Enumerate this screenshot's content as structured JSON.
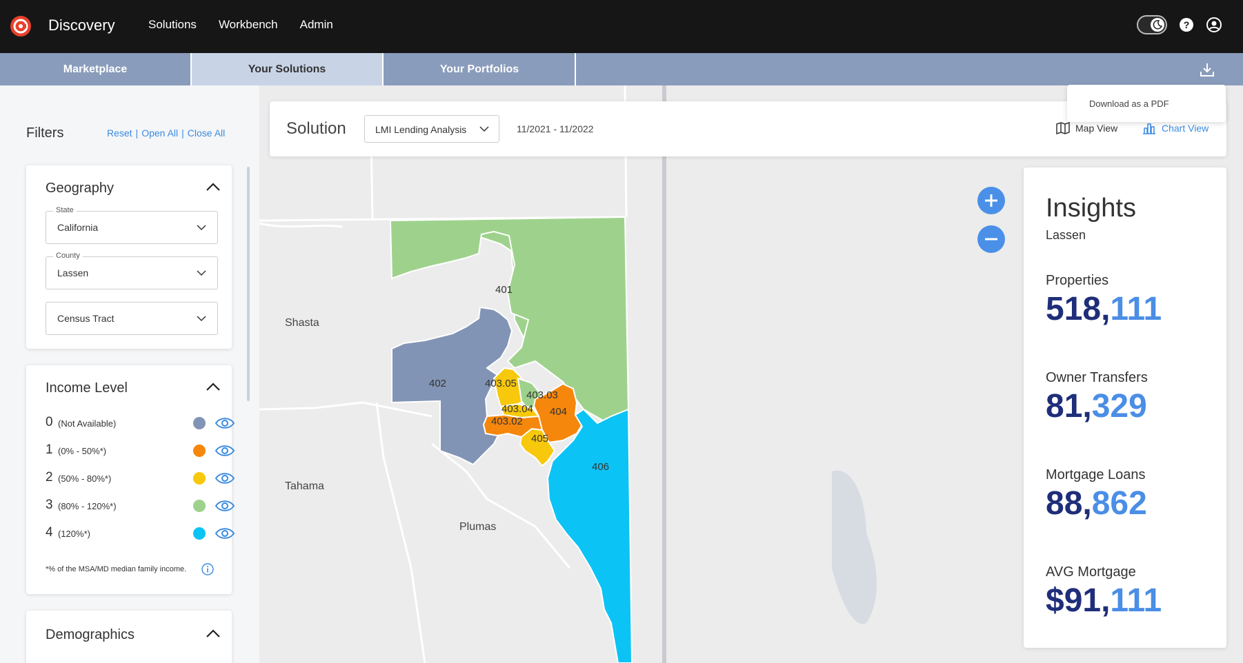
{
  "app": {
    "title": "Discovery"
  },
  "nav": {
    "solutions": "Solutions",
    "workbench": "Workbench",
    "admin": "Admin"
  },
  "tabs": [
    {
      "label": "Marketplace"
    },
    {
      "label": "Your Solutions"
    },
    {
      "label": "Your Portfolios"
    }
  ],
  "download_menu": {
    "item": "Download as a PDF"
  },
  "filters": {
    "title": "Filters",
    "reset": "Reset",
    "open_all": "Open All",
    "close_all": "Close All",
    "separator": "|"
  },
  "geography": {
    "title": "Geography",
    "state": {
      "label": "State",
      "value": "California"
    },
    "county": {
      "label": "County",
      "value": "Lassen"
    },
    "tract": {
      "value": "Census Tract"
    }
  },
  "income": {
    "title": "Income Level",
    "levels": [
      {
        "num": "0",
        "range": "(Not Available)",
        "color": "#8294b5"
      },
      {
        "num": "1",
        "range": "(0% - 50%*)",
        "color": "#f5870c"
      },
      {
        "num": "2",
        "range": "(50% - 80%*)",
        "color": "#f7c80c"
      },
      {
        "num": "3",
        "range": "(80% - 120%*)",
        "color": "#9ed28c"
      },
      {
        "num": "4",
        "range": "(120%*)",
        "color": "#0cc3f5"
      }
    ],
    "footnote": "*% of the MSA/MD median family income."
  },
  "demographics": {
    "title": "Demographics"
  },
  "solution_bar": {
    "title": "Solution",
    "selected": "LMI Lending Analysis",
    "dates": "11/2021 - 11/2022",
    "map_view": "Map View",
    "chart_view": "Chart View"
  },
  "map": {
    "counties": {
      "shasta": "Shasta",
      "tahama": "Tahama",
      "plumas": "Plumas"
    },
    "tracts": {
      "t401": "401",
      "t402": "402",
      "t40305": "403.05",
      "t40303": "403.03",
      "t40304": "403.04",
      "t40302": "403.02",
      "t404": "404",
      "t405": "405",
      "t406": "406"
    }
  },
  "insights": {
    "title": "Insights",
    "subtitle": "Lassen",
    "metrics": [
      {
        "label": "Properties",
        "a": "518,",
        "b": "111"
      },
      {
        "label": "Owner Transfers",
        "a": "81,",
        "b": "329"
      },
      {
        "label": "Mortgage Loans",
        "a": "88,",
        "b": "862"
      },
      {
        "label": "AVG Mortgage",
        "a": "$91,",
        "b": "111"
      }
    ]
  }
}
